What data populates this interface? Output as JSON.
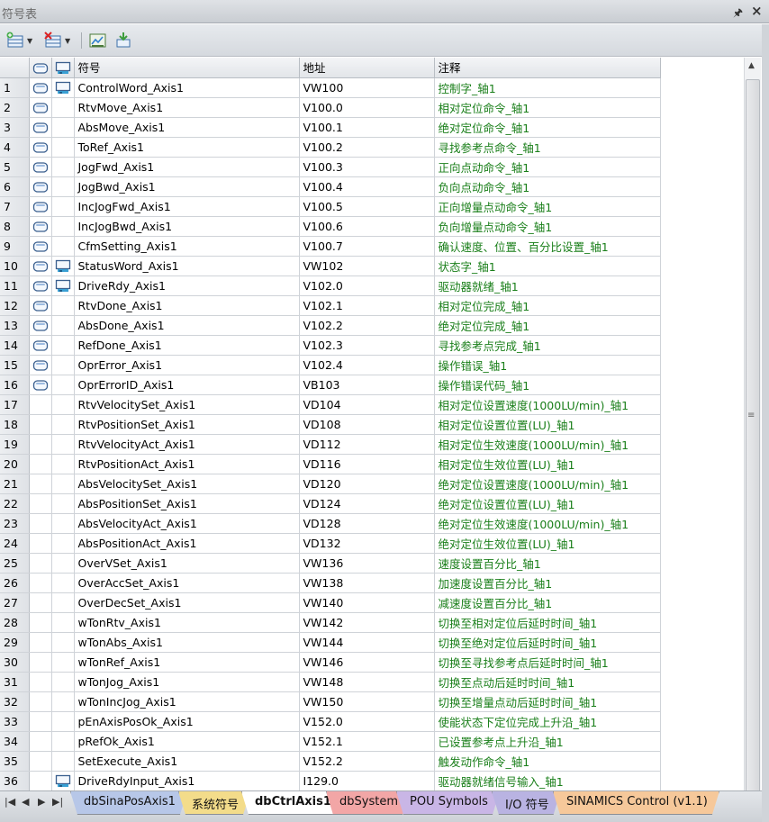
{
  "window": {
    "title": "符号表"
  },
  "toolbar": {
    "icons": [
      "insert-icon",
      "delete-icon",
      "symbol-table-icon",
      "export-icon"
    ]
  },
  "table": {
    "headers": {
      "symbol": "符号",
      "address": "地址",
      "comment": "注释"
    },
    "rows": [
      {
        "num": "1",
        "icons": [
          "var",
          "plc"
        ],
        "symbol": "ControlWord_Axis1",
        "address": "VW100",
        "comment": "控制字_轴1"
      },
      {
        "num": "2",
        "icons": [
          "var"
        ],
        "symbol": "RtvMove_Axis1",
        "address": "V100.0",
        "comment": "相对定位命令_轴1"
      },
      {
        "num": "3",
        "icons": [
          "var"
        ],
        "symbol": "AbsMove_Axis1",
        "address": "V100.1",
        "comment": "绝对定位命令_轴1"
      },
      {
        "num": "4",
        "icons": [
          "var"
        ],
        "symbol": "ToRef_Axis1",
        "address": "V100.2",
        "comment": "寻找参考点命令_轴1"
      },
      {
        "num": "5",
        "icons": [
          "var"
        ],
        "symbol": "JogFwd_Axis1",
        "address": "V100.3",
        "comment": "正向点动命令_轴1"
      },
      {
        "num": "6",
        "icons": [
          "var"
        ],
        "symbol": "JogBwd_Axis1",
        "address": "V100.4",
        "comment": "负向点动命令_轴1"
      },
      {
        "num": "7",
        "icons": [
          "var"
        ],
        "symbol": "IncJogFwd_Axis1",
        "address": "V100.5",
        "comment": "正向增量点动命令_轴1"
      },
      {
        "num": "8",
        "icons": [
          "var"
        ],
        "symbol": "IncJogBwd_Axis1",
        "address": "V100.6",
        "comment": "负向增量点动命令_轴1"
      },
      {
        "num": "9",
        "icons": [
          "var"
        ],
        "symbol": "CfmSetting_Axis1",
        "address": "V100.7",
        "comment": "确认速度、位置、百分比设置_轴1"
      },
      {
        "num": "10",
        "icons": [
          "var",
          "plc"
        ],
        "symbol": "StatusWord_Axis1",
        "address": "VW102",
        "comment": "状态字_轴1"
      },
      {
        "num": "11",
        "icons": [
          "var",
          "plc"
        ],
        "symbol": "DriveRdy_Axis1",
        "address": "V102.0",
        "comment": "驱动器就绪_轴1"
      },
      {
        "num": "12",
        "icons": [
          "var"
        ],
        "symbol": "RtvDone_Axis1",
        "address": "V102.1",
        "comment": "相对定位完成_轴1"
      },
      {
        "num": "13",
        "icons": [
          "var"
        ],
        "symbol": "AbsDone_Axis1",
        "address": "V102.2",
        "comment": "绝对定位完成_轴1"
      },
      {
        "num": "14",
        "icons": [
          "var"
        ],
        "symbol": "RefDone_Axis1",
        "address": "V102.3",
        "comment": "寻找参考点完成_轴1"
      },
      {
        "num": "15",
        "icons": [
          "var"
        ],
        "symbol": "OprError_Axis1",
        "address": "V102.4",
        "comment": "操作错误_轴1"
      },
      {
        "num": "16",
        "icons": [
          "var"
        ],
        "symbol": "OprErrorID_Axis1",
        "address": "VB103",
        "comment": "操作错误代码_轴1"
      },
      {
        "num": "17",
        "icons": [],
        "symbol": "RtvVelocitySet_Axis1",
        "address": "VD104",
        "comment": "相对定位设置速度(1000LU/min)_轴1"
      },
      {
        "num": "18",
        "icons": [],
        "symbol": "RtvPositionSet_Axis1",
        "address": "VD108",
        "comment": "相对定位设置位置(LU)_轴1"
      },
      {
        "num": "19",
        "icons": [],
        "symbol": "RtvVelocityAct_Axis1",
        "address": "VD112",
        "comment": "相对定位生效速度(1000LU/min)_轴1"
      },
      {
        "num": "20",
        "icons": [],
        "symbol": "RtvPositionAct_Axis1",
        "address": "VD116",
        "comment": "相对定位生效位置(LU)_轴1"
      },
      {
        "num": "21",
        "icons": [],
        "symbol": "AbsVelocitySet_Axis1",
        "address": "VD120",
        "comment": "绝对定位设置速度(1000LU/min)_轴1"
      },
      {
        "num": "22",
        "icons": [],
        "symbol": "AbsPositionSet_Axis1",
        "address": "VD124",
        "comment": "绝对定位设置位置(LU)_轴1"
      },
      {
        "num": "23",
        "icons": [],
        "symbol": "AbsVelocityAct_Axis1",
        "address": "VD128",
        "comment": "绝对定位生效速度(1000LU/min)_轴1"
      },
      {
        "num": "24",
        "icons": [],
        "symbol": "AbsPositionAct_Axis1",
        "address": "VD132",
        "comment": "绝对定位生效位置(LU)_轴1"
      },
      {
        "num": "25",
        "icons": [],
        "symbol": "OverVSet_Axis1",
        "address": "VW136",
        "comment": "速度设置百分比_轴1"
      },
      {
        "num": "26",
        "icons": [],
        "symbol": "OverAccSet_Axis1",
        "address": "VW138",
        "comment": "加速度设置百分比_轴1"
      },
      {
        "num": "27",
        "icons": [],
        "symbol": "OverDecSet_Axis1",
        "address": "VW140",
        "comment": "减速度设置百分比_轴1"
      },
      {
        "num": "28",
        "icons": [],
        "symbol": "wTonRtv_Axis1",
        "address": "VW142",
        "comment": "切换至相对定位后延时时间_轴1"
      },
      {
        "num": "29",
        "icons": [],
        "symbol": "wTonAbs_Axis1",
        "address": "VW144",
        "comment": "切换至绝对定位后延时时间_轴1"
      },
      {
        "num": "30",
        "icons": [],
        "symbol": "wTonRef_Axis1",
        "address": "VW146",
        "comment": "切换至寻找参考点后延时时间_轴1"
      },
      {
        "num": "31",
        "icons": [],
        "symbol": "wTonJog_Axis1",
        "address": "VW148",
        "comment": "切换至点动后延时时间_轴1"
      },
      {
        "num": "32",
        "icons": [],
        "symbol": "wTonIncJog_Axis1",
        "address": "VW150",
        "comment": "切换至增量点动后延时时间_轴1"
      },
      {
        "num": "33",
        "icons": [],
        "symbol": "pEnAxisPosOk_Axis1",
        "address": "V152.0",
        "comment": "使能状态下定位完成上升沿_轴1"
      },
      {
        "num": "34",
        "icons": [],
        "symbol": "pRefOk_Axis1",
        "address": "V152.1",
        "comment": "已设置参考点上升沿_轴1"
      },
      {
        "num": "35",
        "icons": [],
        "symbol": "SetExecute_Axis1",
        "address": "V152.2",
        "comment": "触发动作命令_轴1"
      },
      {
        "num": "36",
        "icons": [
          "plc"
        ],
        "symbol": "DriveRdyInput_Axis1",
        "address": "I129.0",
        "comment": "驱动器就绪信号输入_轴1"
      }
    ]
  },
  "tabs": [
    {
      "label": "dbSinaPosAxis1",
      "color": "#b7c7e8",
      "active": false
    },
    {
      "label": "系统符号",
      "color": "#f3dc8a",
      "active": false
    },
    {
      "label": "dbCtrlAxis1",
      "color": "#ffffff",
      "active": true
    },
    {
      "label": "dbSystem",
      "color": "#f2a6a6",
      "active": false
    },
    {
      "label": "POU Symbols",
      "color": "#c9b6e6",
      "active": false
    },
    {
      "label": "I/O 符号",
      "color": "#b9b3e2",
      "active": false
    },
    {
      "label": "SINAMICS Control (v1.1)",
      "color": "#f6c89a",
      "active": false
    }
  ],
  "colors": {
    "comment_text": "#1a7f1a",
    "accent": "#3b78c4"
  }
}
